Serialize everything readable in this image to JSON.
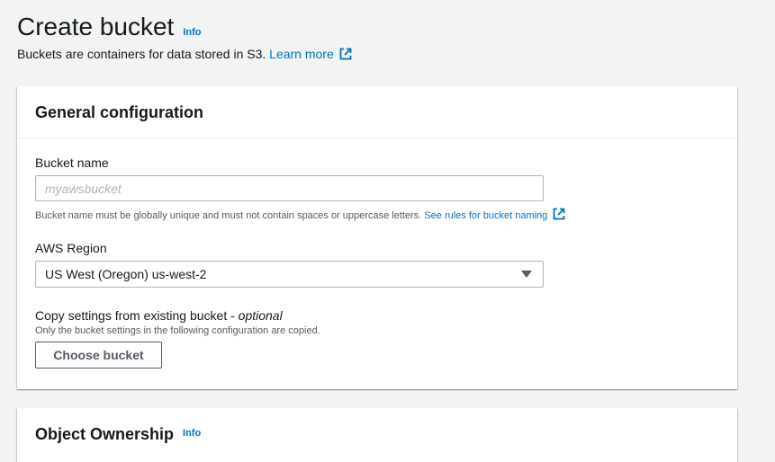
{
  "page": {
    "title": "Create bucket",
    "info_label": "Info",
    "description": "Buckets are containers for data stored in S3.",
    "learn_more": "Learn more",
    "colors": {
      "link": "#0073bb",
      "text": "#16191f",
      "secondary": "#545b64",
      "background": "#f2f3f3"
    }
  },
  "general": {
    "title": "General configuration",
    "bucket_name": {
      "label": "Bucket name",
      "placeholder": "myawsbucket",
      "value": "",
      "hint": "Bucket name must be globally unique and must not contain spaces or uppercase letters.",
      "rules_link": "See rules for bucket naming"
    },
    "region": {
      "label": "AWS Region",
      "selected": "US West (Oregon) us-west-2"
    },
    "copy_settings": {
      "label": "Copy settings from existing bucket - ",
      "optional": "optional",
      "hint": "Only the bucket settings in the following configuration are copied.",
      "button": "Choose bucket"
    }
  },
  "ownership": {
    "title": "Object Ownership",
    "info_label": "Info"
  },
  "icons": {
    "external_link": "external-link-icon",
    "dropdown": "caret-down-icon"
  }
}
